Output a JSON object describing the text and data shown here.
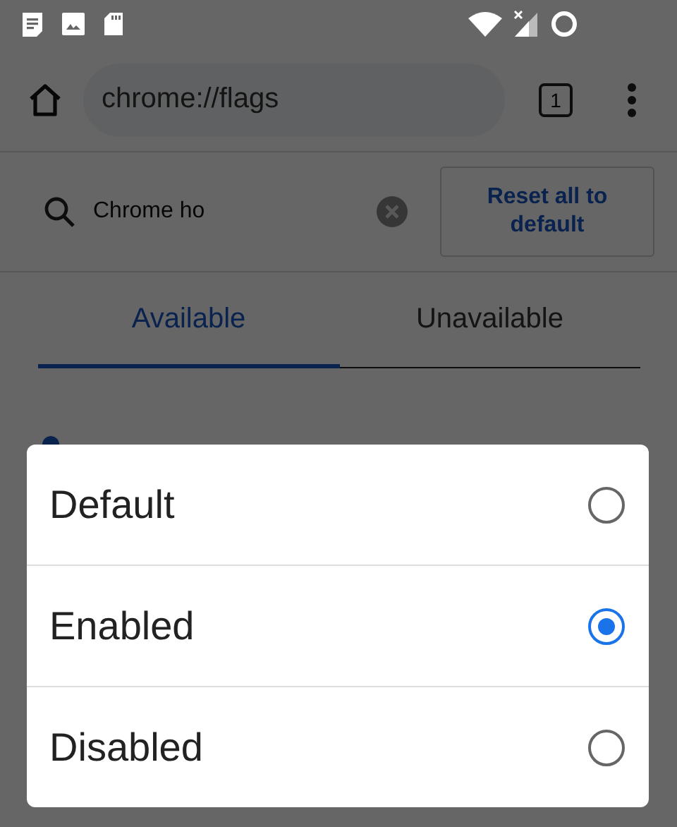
{
  "toolbar": {
    "url": "chrome://flags",
    "tab_count": "1"
  },
  "search": {
    "value": "Chrome ho"
  },
  "reset_button": "Reset all to default",
  "tabs": [
    {
      "label": "Available",
      "selected": true
    },
    {
      "label": "Unavailable",
      "selected": false
    }
  ],
  "dialog": {
    "options": [
      {
        "label": "Default",
        "selected": false
      },
      {
        "label": "Enabled",
        "selected": true
      },
      {
        "label": "Disabled",
        "selected": false
      }
    ]
  }
}
